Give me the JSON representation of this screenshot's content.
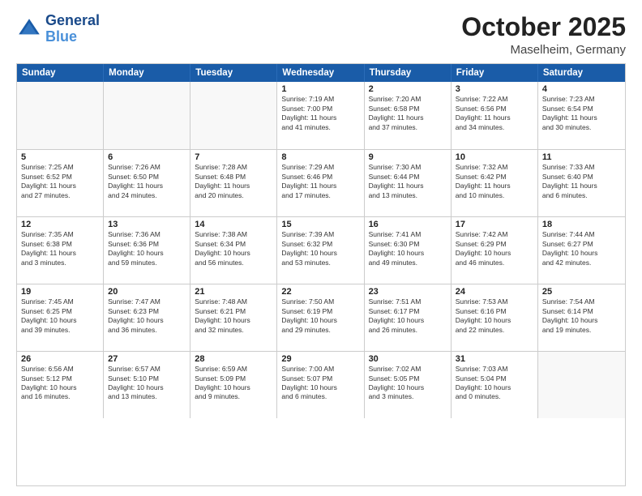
{
  "header": {
    "logo": "GeneralBlue",
    "month": "October 2025",
    "location": "Maselheim, Germany"
  },
  "weekdays": [
    "Sunday",
    "Monday",
    "Tuesday",
    "Wednesday",
    "Thursday",
    "Friday",
    "Saturday"
  ],
  "rows": [
    [
      {
        "day": "",
        "info": ""
      },
      {
        "day": "",
        "info": ""
      },
      {
        "day": "",
        "info": ""
      },
      {
        "day": "1",
        "info": "Sunrise: 7:19 AM\nSunset: 7:00 PM\nDaylight: 11 hours\nand 41 minutes."
      },
      {
        "day": "2",
        "info": "Sunrise: 7:20 AM\nSunset: 6:58 PM\nDaylight: 11 hours\nand 37 minutes."
      },
      {
        "day": "3",
        "info": "Sunrise: 7:22 AM\nSunset: 6:56 PM\nDaylight: 11 hours\nand 34 minutes."
      },
      {
        "day": "4",
        "info": "Sunrise: 7:23 AM\nSunset: 6:54 PM\nDaylight: 11 hours\nand 30 minutes."
      }
    ],
    [
      {
        "day": "5",
        "info": "Sunrise: 7:25 AM\nSunset: 6:52 PM\nDaylight: 11 hours\nand 27 minutes."
      },
      {
        "day": "6",
        "info": "Sunrise: 7:26 AM\nSunset: 6:50 PM\nDaylight: 11 hours\nand 24 minutes."
      },
      {
        "day": "7",
        "info": "Sunrise: 7:28 AM\nSunset: 6:48 PM\nDaylight: 11 hours\nand 20 minutes."
      },
      {
        "day": "8",
        "info": "Sunrise: 7:29 AM\nSunset: 6:46 PM\nDaylight: 11 hours\nand 17 minutes."
      },
      {
        "day": "9",
        "info": "Sunrise: 7:30 AM\nSunset: 6:44 PM\nDaylight: 11 hours\nand 13 minutes."
      },
      {
        "day": "10",
        "info": "Sunrise: 7:32 AM\nSunset: 6:42 PM\nDaylight: 11 hours\nand 10 minutes."
      },
      {
        "day": "11",
        "info": "Sunrise: 7:33 AM\nSunset: 6:40 PM\nDaylight: 11 hours\nand 6 minutes."
      }
    ],
    [
      {
        "day": "12",
        "info": "Sunrise: 7:35 AM\nSunset: 6:38 PM\nDaylight: 11 hours\nand 3 minutes."
      },
      {
        "day": "13",
        "info": "Sunrise: 7:36 AM\nSunset: 6:36 PM\nDaylight: 10 hours\nand 59 minutes."
      },
      {
        "day": "14",
        "info": "Sunrise: 7:38 AM\nSunset: 6:34 PM\nDaylight: 10 hours\nand 56 minutes."
      },
      {
        "day": "15",
        "info": "Sunrise: 7:39 AM\nSunset: 6:32 PM\nDaylight: 10 hours\nand 53 minutes."
      },
      {
        "day": "16",
        "info": "Sunrise: 7:41 AM\nSunset: 6:30 PM\nDaylight: 10 hours\nand 49 minutes."
      },
      {
        "day": "17",
        "info": "Sunrise: 7:42 AM\nSunset: 6:29 PM\nDaylight: 10 hours\nand 46 minutes."
      },
      {
        "day": "18",
        "info": "Sunrise: 7:44 AM\nSunset: 6:27 PM\nDaylight: 10 hours\nand 42 minutes."
      }
    ],
    [
      {
        "day": "19",
        "info": "Sunrise: 7:45 AM\nSunset: 6:25 PM\nDaylight: 10 hours\nand 39 minutes."
      },
      {
        "day": "20",
        "info": "Sunrise: 7:47 AM\nSunset: 6:23 PM\nDaylight: 10 hours\nand 36 minutes."
      },
      {
        "day": "21",
        "info": "Sunrise: 7:48 AM\nSunset: 6:21 PM\nDaylight: 10 hours\nand 32 minutes."
      },
      {
        "day": "22",
        "info": "Sunrise: 7:50 AM\nSunset: 6:19 PM\nDaylight: 10 hours\nand 29 minutes."
      },
      {
        "day": "23",
        "info": "Sunrise: 7:51 AM\nSunset: 6:17 PM\nDaylight: 10 hours\nand 26 minutes."
      },
      {
        "day": "24",
        "info": "Sunrise: 7:53 AM\nSunset: 6:16 PM\nDaylight: 10 hours\nand 22 minutes."
      },
      {
        "day": "25",
        "info": "Sunrise: 7:54 AM\nSunset: 6:14 PM\nDaylight: 10 hours\nand 19 minutes."
      }
    ],
    [
      {
        "day": "26",
        "info": "Sunrise: 6:56 AM\nSunset: 5:12 PM\nDaylight: 10 hours\nand 16 minutes."
      },
      {
        "day": "27",
        "info": "Sunrise: 6:57 AM\nSunset: 5:10 PM\nDaylight: 10 hours\nand 13 minutes."
      },
      {
        "day": "28",
        "info": "Sunrise: 6:59 AM\nSunset: 5:09 PM\nDaylight: 10 hours\nand 9 minutes."
      },
      {
        "day": "29",
        "info": "Sunrise: 7:00 AM\nSunset: 5:07 PM\nDaylight: 10 hours\nand 6 minutes."
      },
      {
        "day": "30",
        "info": "Sunrise: 7:02 AM\nSunset: 5:05 PM\nDaylight: 10 hours\nand 3 minutes."
      },
      {
        "day": "31",
        "info": "Sunrise: 7:03 AM\nSunset: 5:04 PM\nDaylight: 10 hours\nand 0 minutes."
      },
      {
        "day": "",
        "info": ""
      }
    ]
  ]
}
